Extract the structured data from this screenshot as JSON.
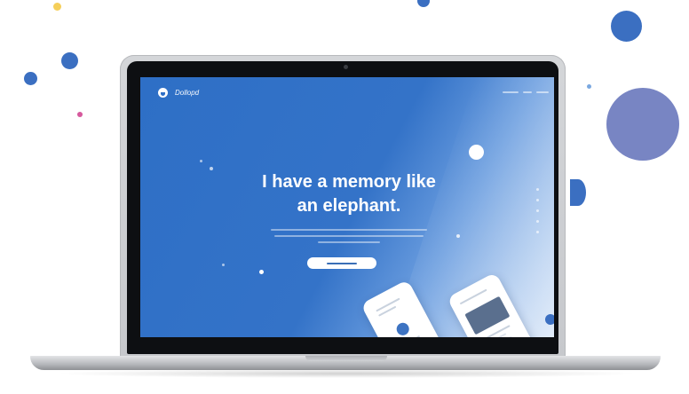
{
  "colors": {
    "background": "#ffffff",
    "screen_blue": "#2e6fc6",
    "dot_blue": "#3b6fc1",
    "dot_purple": "#7885c3",
    "dot_yellow": "#f5cf5a",
    "dot_pink": "#d6599d"
  },
  "site": {
    "logo_icon": "elephant-logo-icon",
    "logo_text": "Dollopd",
    "headline_line1": "I have a memory like",
    "headline_line2": "an elephant."
  },
  "laptop": {
    "device": "macbook-air",
    "screen": "landing-page"
  }
}
